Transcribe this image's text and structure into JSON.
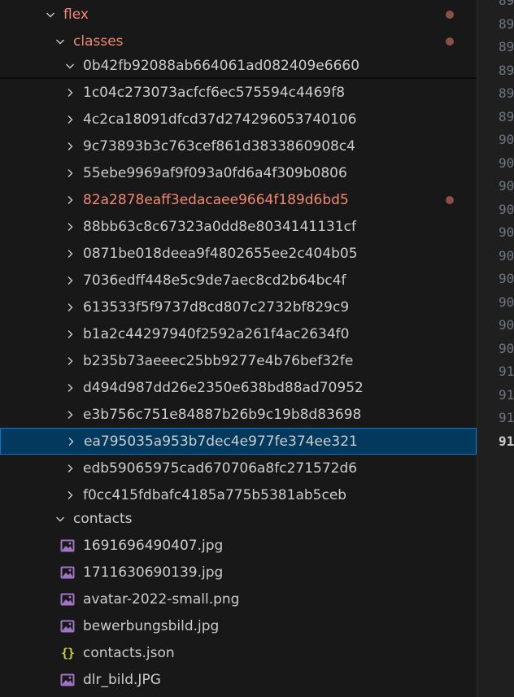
{
  "tree": {
    "flex_folder": {
      "label": "flex",
      "modified": true
    },
    "classes_folder": {
      "label": "classes",
      "modified": true
    },
    "class_folders": [
      {
        "label": "0b42fb92088ab664061ad082409e6660",
        "expanded": true
      },
      {
        "label": "1c04c273073acfcf6ec575594c4469f8"
      },
      {
        "label": "4c2ca18091dfcd37d274296053740106"
      },
      {
        "label": "9c73893b3c763cef861d3833860908c4"
      },
      {
        "label": "55ebe9969af9f093a0fd6a4f309b0806"
      },
      {
        "label": "82a2878eaff3edacaee9664f189d6bd5",
        "modified": true
      },
      {
        "label": "88bb63c8c67323a0dd8e8034141131cf"
      },
      {
        "label": "0871be018deea9f4802655ee2c404b05"
      },
      {
        "label": "7036edff448e5c9de7aec8cd2b64bc4f"
      },
      {
        "label": "613533f5f9737d8cd807c2732bf829c9"
      },
      {
        "label": "b1a2c44297940f2592a261f4ac2634f0"
      },
      {
        "label": "b235b73aeeec25bb9277e4b76bef32fe"
      },
      {
        "label": "d494d987dd26e2350e638bd88ad70952"
      },
      {
        "label": "e3b756c751e84887b26b9c19b8d83698"
      },
      {
        "label": "ea795035a953b7dec4e977fe374ee321",
        "selected": true
      },
      {
        "label": "edb59065975cad670706a8fc271572d6"
      },
      {
        "label": "f0cc415fdbafc4185a775b5381ab5ceb"
      }
    ],
    "contacts_folder": {
      "label": "contacts"
    },
    "contacts_files": [
      {
        "label": "1691696490407.jpg",
        "icon": "image-file-icon"
      },
      {
        "label": "1711630690139.jpg",
        "icon": "image-file-icon"
      },
      {
        "label": "avatar-2022-small.png",
        "icon": "image-file-icon"
      },
      {
        "label": "bewerbungsbild.jpg",
        "icon": "image-file-icon"
      },
      {
        "label": "contacts.json",
        "icon": "json-file-icon"
      },
      {
        "label": "dlr_bild.JPG",
        "icon": "image-file-icon"
      }
    ]
  },
  "gutter": {
    "line_numbers": [
      "89",
      "89",
      "89",
      "89",
      "89",
      "89",
      "90",
      "90",
      "90",
      "90",
      "90",
      "90",
      "90",
      "90",
      "90",
      "90",
      "91",
      "91",
      "91",
      "91"
    ],
    "active_index": 19
  },
  "colors": {
    "modified": "#f48771",
    "selection_bg": "#04395e",
    "selection_border": "#0078d4",
    "modified_dot": "#8c5047",
    "image_icon": "#a074c4",
    "json_icon": "#cbcb41"
  }
}
